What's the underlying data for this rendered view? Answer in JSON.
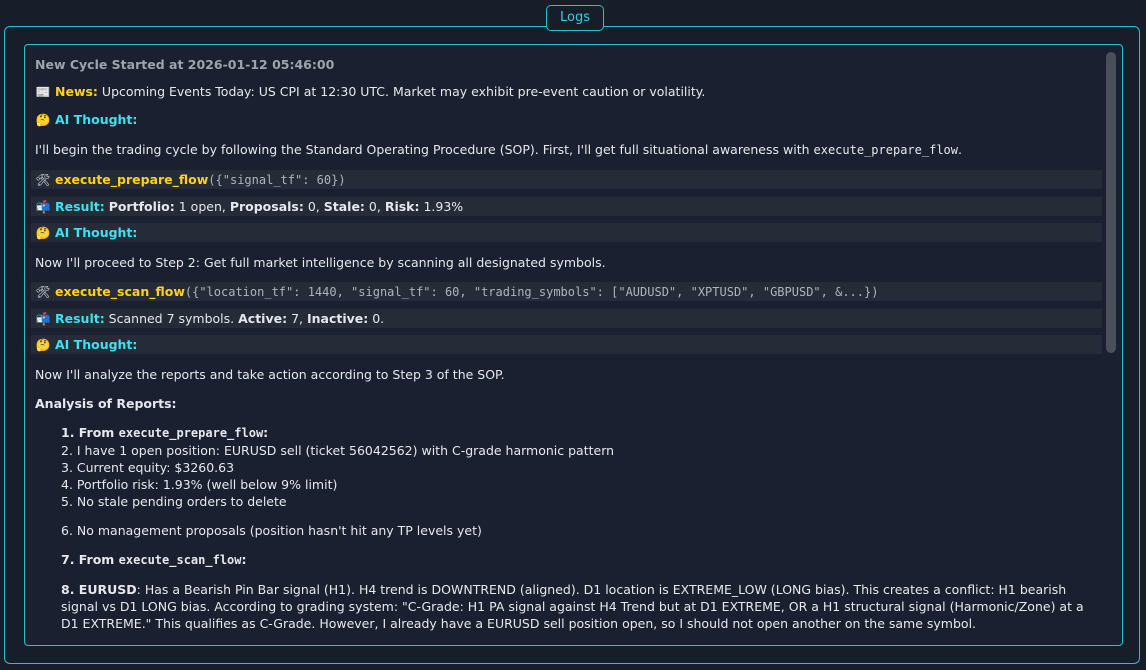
{
  "window": {
    "tab_label": "Logs"
  },
  "log": {
    "cycle_header": "New Cycle Started at 2026-01-12 05:46:00",
    "news": {
      "icon": "newspaper-icon",
      "label": "News:",
      "text": "Upcoming Events Today: US CPI at 12:30 UTC. Market may exhibit pre-event caution or volatility."
    },
    "thought1": {
      "icon": "thinking-face-icon",
      "label": "AI Thought:"
    },
    "thought1_text_before": "I'll begin the trading cycle by following the Standard Operating Procedure (SOP). First, I'll get full situational awareness with ",
    "thought1_code": "execute_prepare_flow",
    "thought1_text_after": ".",
    "call1": {
      "icon": "tools-icon",
      "name": "execute_prepare_flow",
      "args": "({\"signal_tf\": 60})"
    },
    "result1": {
      "icon": "inbox-icon",
      "label": "Result:",
      "k1": "Portfolio:",
      "v1": " 1 open, ",
      "k2": "Proposals:",
      "v2": " 0, ",
      "k3": "Stale:",
      "v3": " 0, ",
      "k4": "Risk:",
      "v4": " 1.93%"
    },
    "thought2": {
      "icon": "thinking-face-icon",
      "label": "AI Thought:"
    },
    "thought2_text": "Now I'll proceed to Step 2: Get full market intelligence by scanning all designated symbols.",
    "call2": {
      "icon": "tools-icon",
      "name": "execute_scan_flow",
      "args": "({\"location_tf\": 1440, \"signal_tf\": 60, \"trading_symbols\": [\"AUDUSD\", \"XPTUSD\", \"GBPUSD\", &...})"
    },
    "result2": {
      "icon": "inbox-icon",
      "label": "Result:",
      "text": " Scanned 7 symbols. ",
      "k1": "Active:",
      "v1": " 7, ",
      "k2": "Inactive:",
      "v2": " 0."
    },
    "thought3": {
      "icon": "thinking-face-icon",
      "label": "AI Thought:"
    },
    "thought3_text": "Now I'll analyze the reports and take action according to Step 3 of the SOP.",
    "analysis_heading": "Analysis of Reports:",
    "item1_prefix": "1. From ",
    "item1_code": "execute_prepare_flow",
    "item1_suffix": ":",
    "item2": "2. I have 1 open position: EURUSD sell (ticket 56042562) with C-grade harmonic pattern",
    "item3": "3. Current equity: $3260.63",
    "item4": "4. Portfolio risk: 1.93% (well below 9% limit)",
    "item5": "5. No stale pending orders to delete",
    "item6": "6. No management proposals (position hasn't hit any TP levels yet)",
    "item7_prefix": "7. From ",
    "item7_code": "execute_scan_flow",
    "item7_suffix": ":",
    "item8_label": "8. EURUSD",
    "item8_text": ": Has a Bearish Pin Bar signal (H1). H4 trend is DOWNTREND (aligned). D1 location is EXTREME_LOW (LONG bias). This creates a conflict: H1 bearish signal vs D1 LONG bias. According to grading system: \"C-Grade: H1 PA signal against H4 Trend but at D1 EXTREME, OR a H1 structural signal (Harmonic/Zone) at a D1 EXTREME.\" This qualifies as C-Grade. However, I already have a EURUSD sell position open, so I should not open another on the same symbol."
  },
  "colors": {
    "accent_border": "#20c5cf",
    "label_yellow": "#ffd21e",
    "label_cyan": "#3fe0f0",
    "background": "#181d2a"
  }
}
